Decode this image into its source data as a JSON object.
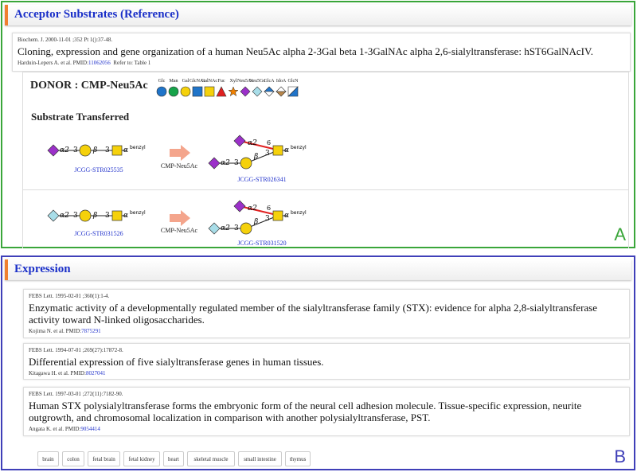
{
  "panel_a": {
    "header": "Acceptor Substrates (Reference)",
    "letter": "A",
    "reference": {
      "journal": "Biochem. J. 2000-11-01 ;352 Pt 1():37-48.",
      "title": "Cloning, expression and gene organization of a human Neu5Ac alpha 2-3Gal beta 1-3GalNAc alpha 2,6-sialyltransferase: hST6GalNAcIV.",
      "authors": "Harduin-Lepers A. et al. PMID:",
      "pmid": "11062056",
      "refer_to": "Refer to: Table 1"
    },
    "donor_label": "DONOR : CMP-Neu5Ac",
    "legend": [
      {
        "label": "Glc",
        "shape": "circle",
        "color": "#1f74c9"
      },
      {
        "label": "Man",
        "shape": "circle",
        "color": "#17a34a"
      },
      {
        "label": "Gal",
        "shape": "circle",
        "color": "#f5d10b"
      },
      {
        "label": "GlcNAc",
        "shape": "square",
        "color": "#1f74c9"
      },
      {
        "label": "GalNAc",
        "shape": "square",
        "color": "#f5d10b"
      },
      {
        "label": "Fuc",
        "shape": "triangle",
        "color": "#e02020"
      },
      {
        "label": "Xyl",
        "shape": "star",
        "color": "#f08000"
      },
      {
        "label": "Neu5Ac",
        "shape": "diamond",
        "color": "#9b30c9"
      },
      {
        "label": "Neu5Gc",
        "shape": "diamond",
        "color": "#a8dde8"
      },
      {
        "label": "GlcA",
        "shape": "diamond-split",
        "color": "#1f74c9"
      },
      {
        "label": "IdoA",
        "shape": "diamond-split-tan",
        "color": "#b8864a"
      },
      {
        "label": "GlcN",
        "shape": "square-split",
        "color": "#1f74c9"
      }
    ],
    "substrate_title": "Substrate Transferred",
    "reactions": [
      {
        "acceptor_code": "JCGG-STR025535",
        "acceptor_top_sugar": "Neu5Ac",
        "arrow_label": "CMP-Neu5Ac",
        "product_code": "JCGG-STR026341"
      },
      {
        "acceptor_code": "JCGG-STR031526",
        "acceptor_top_sugar": "Neu5Gc",
        "arrow_label": "CMP-Neu5Ac",
        "product_code": "JCGG-STR031520"
      }
    ],
    "glycan_text": {
      "alpha": "α",
      "beta": "β",
      "alpha2": "α2",
      "three": "3",
      "six": "6",
      "benzyl": "benzyl"
    },
    "colors": {
      "neu5ac": "#9b30c9",
      "neu5gc": "#a8dde8",
      "gal": "#f5d10b",
      "galnac": "#f5d10b",
      "arrow": "#f4a58c",
      "new_bond": "#e02020"
    }
  },
  "panel_b": {
    "header": "Expression",
    "letter": "B",
    "references": [
      {
        "journal": "FEBS Lett. 1995-02-01 ;360(1):1-4.",
        "title": "Enzymatic activity of a developmentally regulated member of the sialyltransferase family (STX): evidence for alpha 2,8-sialyltransferase activity toward N-linked oligosaccharides.",
        "authors": "Kojima N. et al. PMID:",
        "pmid": "7875291"
      },
      {
        "journal": "FEBS Lett. 1994-07-01 ;269(27):17872-8.",
        "title": "Differential expression of five sialyltransferase genes in human tissues.",
        "authors": "Kitagawa H. et al. PMID:",
        "pmid": "8027041"
      },
      {
        "journal": "FEBS Lett. 1997-03-01 ;272(11):7182-90.",
        "title": "Human STX polysialyltransferase forms the embryonic form of the neural cell adhesion molecule. Tissue-specific expression, neurite outgrowth, and chromosomal localization in comparison with another polysialyltransferase, PST.",
        "authors": "Angata K. et al. PMID:",
        "pmid": "9054414"
      }
    ],
    "tissues": [
      "brain",
      "colon",
      "fetal brain",
      "fetal kidney",
      "heart",
      "skeletal muscle",
      "small intestine",
      "thymus"
    ]
  }
}
